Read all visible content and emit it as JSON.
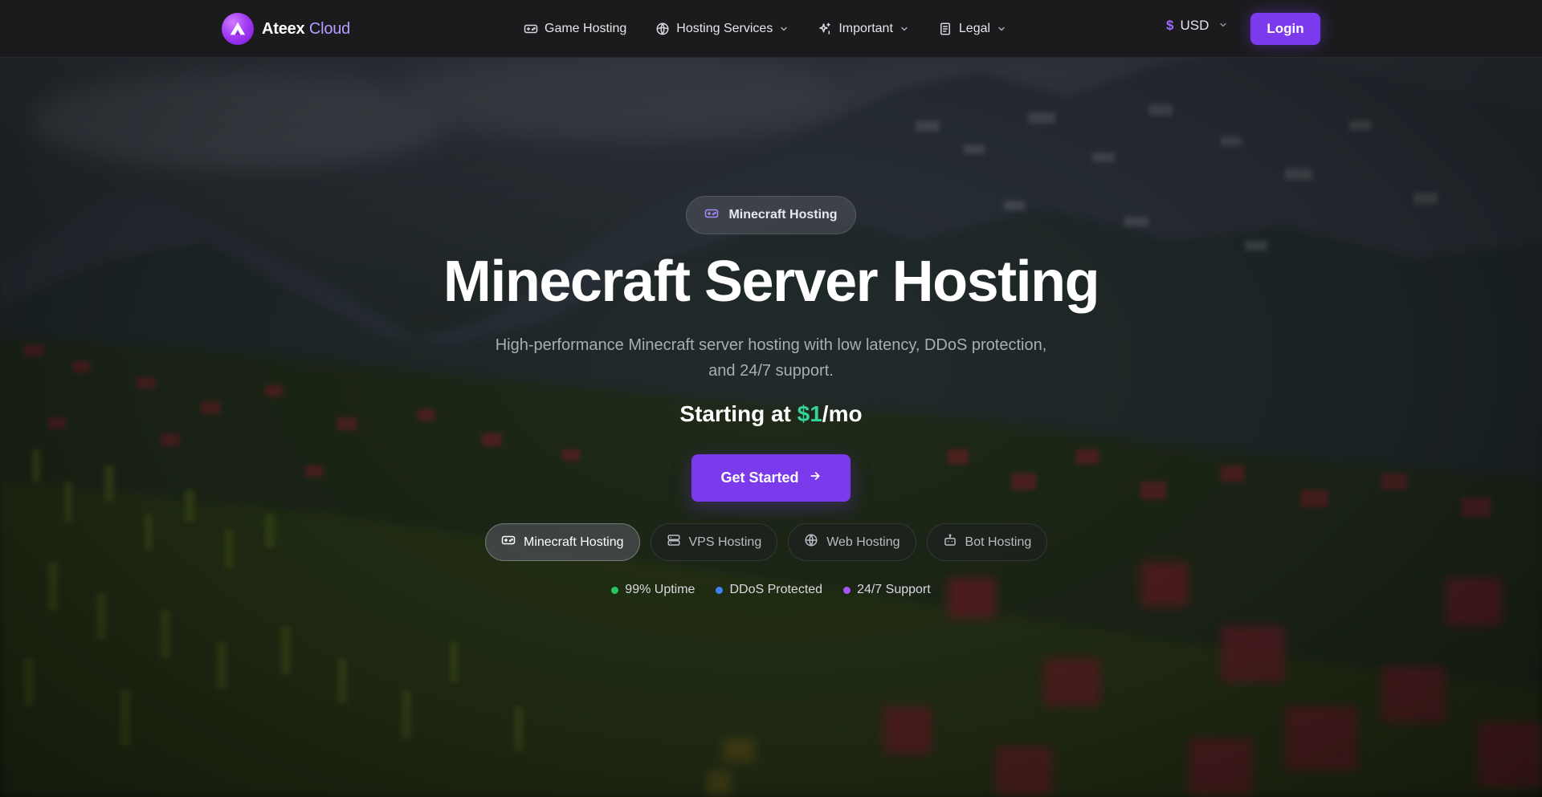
{
  "brand": {
    "name_part1": "Ateex",
    "name_part2": "Cloud"
  },
  "nav": {
    "items": [
      {
        "label": "Game Hosting",
        "icon": "gamepad-icon",
        "has_dropdown": false
      },
      {
        "label": "Hosting Services",
        "icon": "globe-icon",
        "has_dropdown": true
      },
      {
        "label": "Important",
        "icon": "sparkle-icon",
        "has_dropdown": true
      },
      {
        "label": "Legal",
        "icon": "document-icon",
        "has_dropdown": true
      }
    ],
    "currency": {
      "symbol": "$",
      "code": "USD"
    },
    "login_label": "Login"
  },
  "hero": {
    "badge_label": "Minecraft Hosting",
    "title": "Minecraft Server Hosting",
    "subtitle": "High-performance Minecraft server hosting with low latency, DDoS protection, and 24/7 support.",
    "price_prefix": "Starting at ",
    "price_amount": "$1",
    "price_suffix": "/mo",
    "cta_label": "Get Started"
  },
  "tabs": [
    {
      "label": "Minecraft Hosting",
      "icon": "gamepad-icon",
      "active": true
    },
    {
      "label": "VPS Hosting",
      "icon": "server-icon",
      "active": false
    },
    {
      "label": "Web Hosting",
      "icon": "globe-icon",
      "active": false
    },
    {
      "label": "Bot Hosting",
      "icon": "bot-icon",
      "active": false
    }
  ],
  "features": [
    {
      "label": "99% Uptime",
      "color": "#22c55e"
    },
    {
      "label": "DDoS Protected",
      "color": "#3b82f6"
    },
    {
      "label": "24/7 Support",
      "color": "#a855f7"
    }
  ],
  "colors": {
    "accent": "#7c3aed",
    "price_green": "#34d399",
    "nav_bg": "#1b1b1d"
  }
}
